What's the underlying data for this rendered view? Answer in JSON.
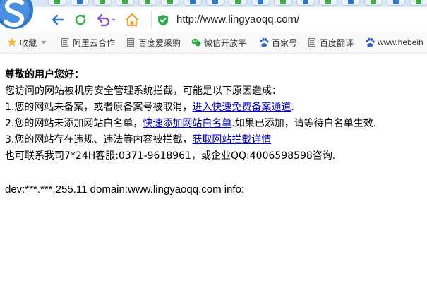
{
  "browser": {
    "address_bar": {
      "url": "http://www.lingyaoqq.com/"
    },
    "bookmarks": [
      {
        "label": "收藏",
        "icon": "star-icon"
      },
      {
        "label": "阿里云合作",
        "icon": "page-icon"
      },
      {
        "label": "百度爱采购",
        "icon": "page-icon"
      },
      {
        "label": "微信开放平",
        "icon": "wechat-icon"
      },
      {
        "label": "百家号",
        "icon": "baidu-paw-icon"
      },
      {
        "label": "百度翻译",
        "icon": "page-icon"
      },
      {
        "label": "www.hebeih",
        "icon": "baidu-paw-icon"
      }
    ],
    "colors": {
      "accent_blue": "#2f78d2",
      "refresh_green": "#3cb34a",
      "back_purple": "#8a56c6",
      "home_orange": "#f3a23a",
      "shield_green": "#35a853"
    }
  },
  "page": {
    "greeting": "尊敬的用户您好：",
    "intro": "您访问的网站被机房安全管理系统拦截，可能是以下原因造成：",
    "reason1": {
      "text": "1.您的网站未备案，或者原备案号被取消，",
      "link": "进入快速免费备案通道",
      "suffix": "."
    },
    "reason2": {
      "text": "2.您的网站未添加网站白名单，",
      "link": "快速添加网站白名单",
      "suffix": ".如果已添加，请等待白名单生效."
    },
    "reason3": {
      "text": "3.您的网站存在违规、违法等内容被拦截，",
      "link": "获取网站拦截详情"
    },
    "contact": "也可联系我司7*24H客服:0371-9618961，或企业QQ:4006598598咨询.",
    "debug": "dev:***.***.255.11 domain:www.lingyaoqq.com info:"
  }
}
